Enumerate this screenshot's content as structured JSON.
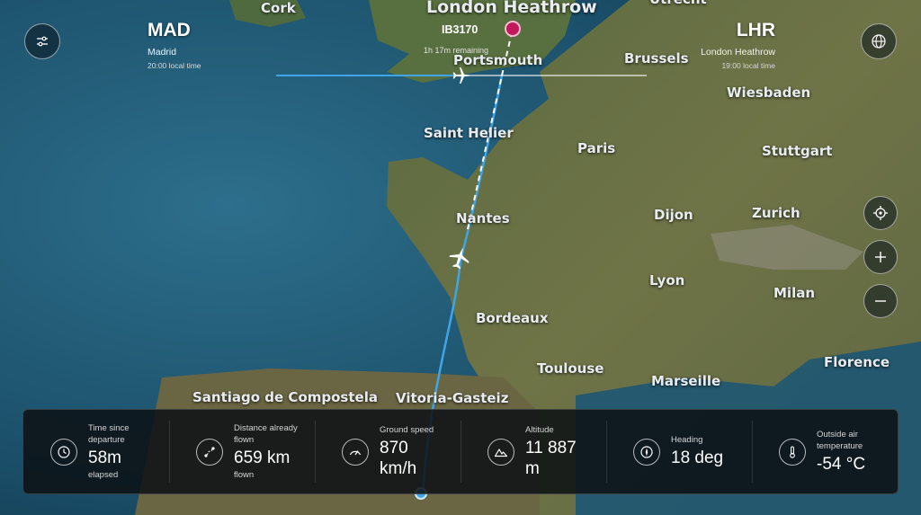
{
  "origin": {
    "code": "MAD",
    "city": "Madrid",
    "local_time": "20:00 local time"
  },
  "destination": {
    "code": "LHR",
    "city": "London Heathrow",
    "local_time": "19:00 local time"
  },
  "flight": {
    "number": "IB3170",
    "remaining": "1h 17m remaining",
    "progress": 0.5
  },
  "map_labels": [
    "Cork",
    "London Heathrow",
    "Utrecht",
    "Portsmouth",
    "Brussels",
    "Wiesbaden",
    "Saint Helier",
    "Paris",
    "Stuttgart",
    "Nantes",
    "Dijon",
    "Zurich",
    "Lyon",
    "Milan",
    "Bordeaux",
    "Toulouse",
    "Marseille",
    "Florence",
    "Santiago de Compostela",
    "Vitoria-Gasteiz"
  ],
  "controls": {
    "settings_icon": "sliders-icon",
    "globe_icon": "globe-icon",
    "locate_icon": "crosshair-icon",
    "zoom_in_icon": "plus-icon",
    "zoom_out_icon": "minus-icon"
  },
  "stats": [
    {
      "label": "Time since departure",
      "value": "58m",
      "sub": "elapsed",
      "icon": "clock-icon"
    },
    {
      "label": "Distance already flown",
      "value": "659 km",
      "sub": "flown",
      "icon": "route-icon"
    },
    {
      "label": "Ground speed",
      "value": "870 km/h",
      "sub": "",
      "icon": "speedometer-icon"
    },
    {
      "label": "Altitude",
      "value": "11 887 m",
      "sub": "",
      "icon": "mountain-icon"
    },
    {
      "label": "Heading",
      "value": "18 deg",
      "sub": "",
      "icon": "compass-icon"
    },
    {
      "label": "Outside air temperature",
      "value": "-54 °C",
      "sub": "",
      "icon": "thermometer-icon"
    }
  ],
  "colors": {
    "route": "#3ea6e8",
    "destination_marker": "#c2185b",
    "panel": "#0c1014"
  }
}
